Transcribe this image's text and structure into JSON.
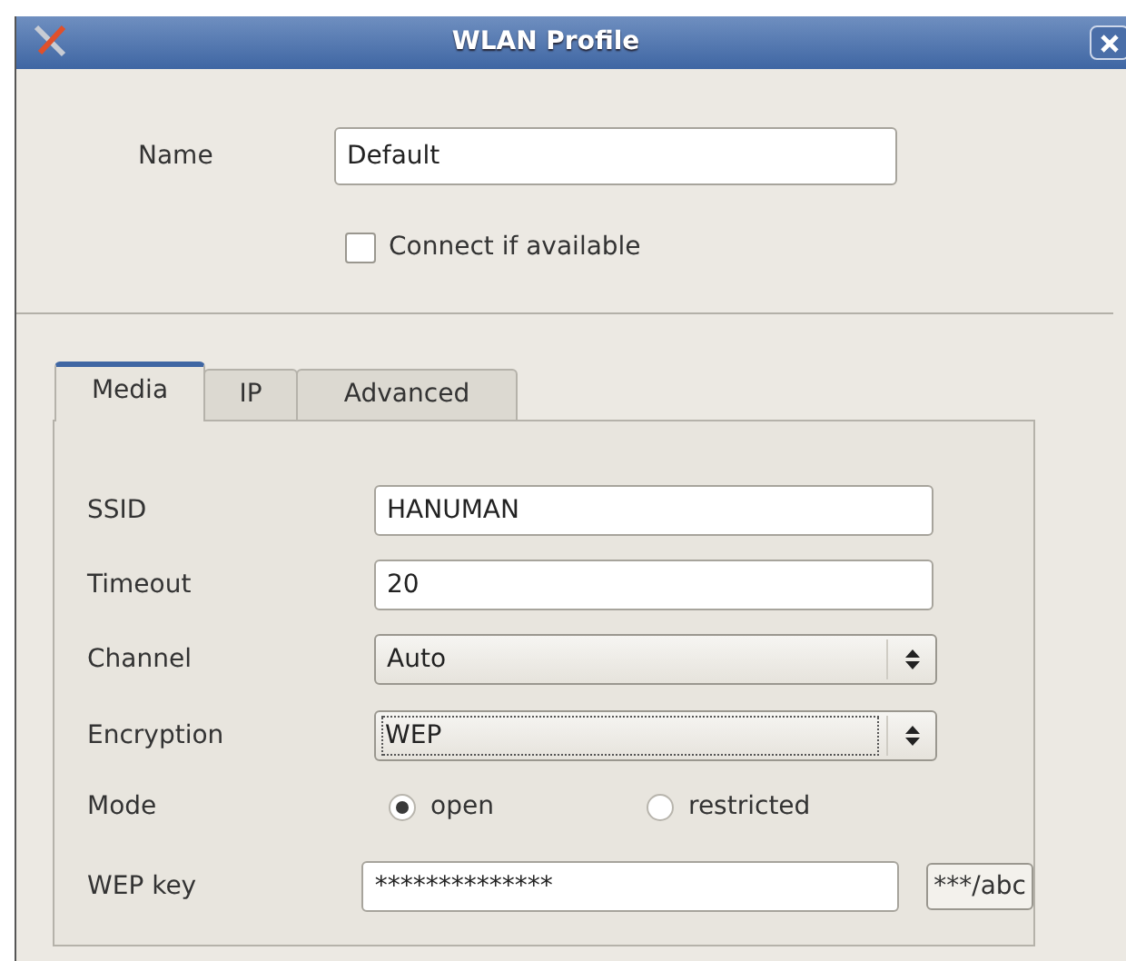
{
  "window": {
    "title": "WLAN Profile"
  },
  "name": {
    "label": "Name",
    "value": "Default"
  },
  "connect_if_available": {
    "label": "Connect if available",
    "checked": false
  },
  "tabs": [
    {
      "label": "Media",
      "selected": true
    },
    {
      "label": "IP",
      "selected": false
    },
    {
      "label": "Advanced",
      "selected": false
    }
  ],
  "fields": [
    {
      "kind": "text",
      "label": "SSID",
      "value": "HANUMAN"
    },
    {
      "kind": "text",
      "label": "Timeout",
      "value": "20"
    },
    {
      "kind": "select",
      "label": "Channel",
      "value": "Auto",
      "focused": false
    },
    {
      "kind": "select",
      "label": "Encryption",
      "value": "WEP",
      "focused": true
    },
    {
      "kind": "radio",
      "label": "Mode",
      "options": [
        {
          "label": "open",
          "selected": true
        },
        {
          "label": "restricted",
          "selected": false
        }
      ]
    },
    {
      "kind": "password",
      "label": "WEP key",
      "value": "**************",
      "toggle": "***/abc"
    }
  ]
}
